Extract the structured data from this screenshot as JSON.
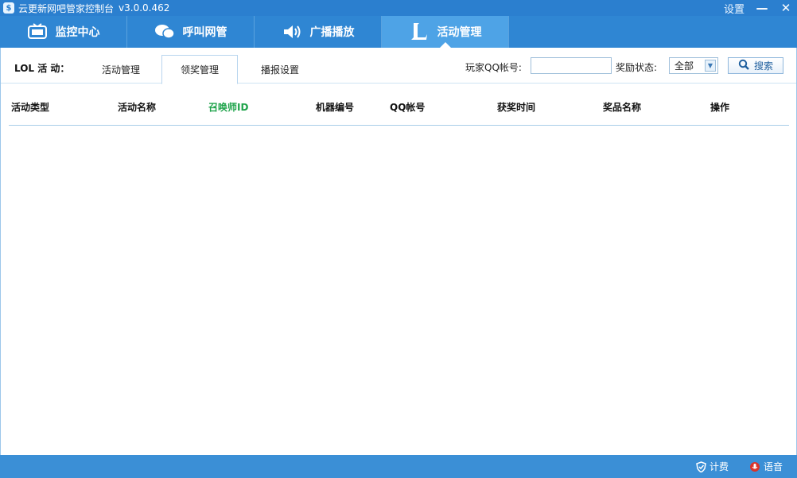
{
  "window": {
    "title": "云更新网吧管家控制台",
    "version": "v3.0.0.462",
    "settings_label": "设置",
    "minimize_glyph": "—",
    "close_glyph": "✕",
    "logo_glyph": "$"
  },
  "nav": {
    "tabs": [
      {
        "label": "监控中心",
        "icon": "tv-monitor-icon"
      },
      {
        "label": "呼叫网管",
        "icon": "chat-bubbles-icon"
      },
      {
        "label": "广播播放",
        "icon": "speaker-icon"
      },
      {
        "label": "活动管理",
        "icon": "lol-logo-icon",
        "active": true
      }
    ]
  },
  "toolbar": {
    "section_label": "LOL 活 动：",
    "sub_tabs": [
      {
        "label": "活动管理"
      },
      {
        "label": "领奖管理",
        "active": true
      },
      {
        "label": "播报设置"
      }
    ],
    "qq_label": "玩家QQ帐号:",
    "qq_value": "",
    "status_label": "奖励状态:",
    "status_value": "全部",
    "search_label": "搜索"
  },
  "table": {
    "columns": [
      {
        "label": "活动类型"
      },
      {
        "label": "活动名称"
      },
      {
        "label": "召唤师ID",
        "highlight": true
      },
      {
        "label": "机器编号"
      },
      {
        "label": "QQ帐号"
      },
      {
        "label": "获奖时间"
      },
      {
        "label": "奖品名称"
      },
      {
        "label": "操作"
      }
    ],
    "rows": []
  },
  "statusbar": {
    "left_label": "计费",
    "right_label": "语音"
  },
  "colors": {
    "titlebar": "#2b7fcf",
    "nav": "#2f86d3",
    "nav_active": "#4ea3e6",
    "highlight_column": "#1ea34a"
  }
}
